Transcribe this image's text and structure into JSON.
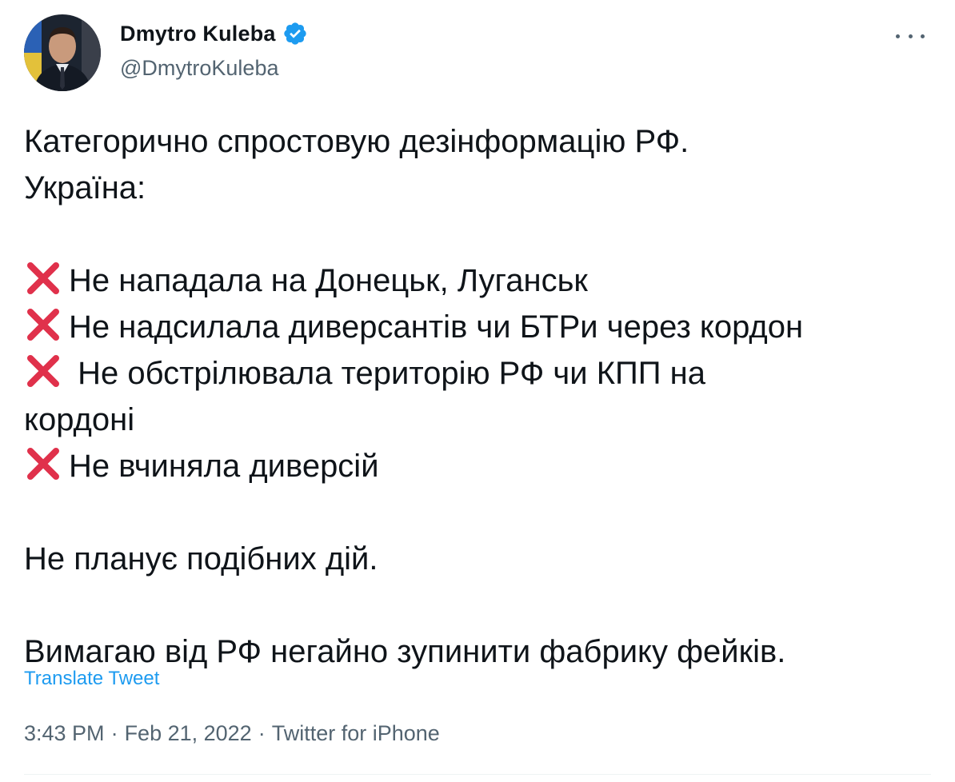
{
  "author": {
    "display_name": "Dmytro Kuleba",
    "handle": "@DmytroKuleba",
    "verified": true
  },
  "tweet": {
    "lines": {
      "l1": "Категорично спростовую дезінформацію РФ.",
      "l2": "Україна:",
      "l3": "Не нападала на Донецьк, Луганськ",
      "l4": "Не надсилала диверсантів чи БТРи через кордон",
      "l5": " Не обстрілювала територію РФ чи КПП на кордоні",
      "l6": "Не вчиняла диверсій",
      "l7": "Не планує подібних дій.",
      "l8": "Вимагаю від РФ негайно зупинити фабрику фейків."
    },
    "translate_label": "Translate Tweet",
    "time": "3:43 PM",
    "date": "Feb 21, 2022",
    "source": "Twitter for iPhone",
    "separator": "·"
  },
  "icons": {
    "more": "more-horizontal-icon",
    "verified": "verified-badge-icon",
    "cross": "cross-mark-emoji"
  },
  "colors": {
    "link": "#1d9bf0",
    "verified": "#1d9bf0",
    "secondary_text": "#536471",
    "cross": "#e0314b"
  }
}
